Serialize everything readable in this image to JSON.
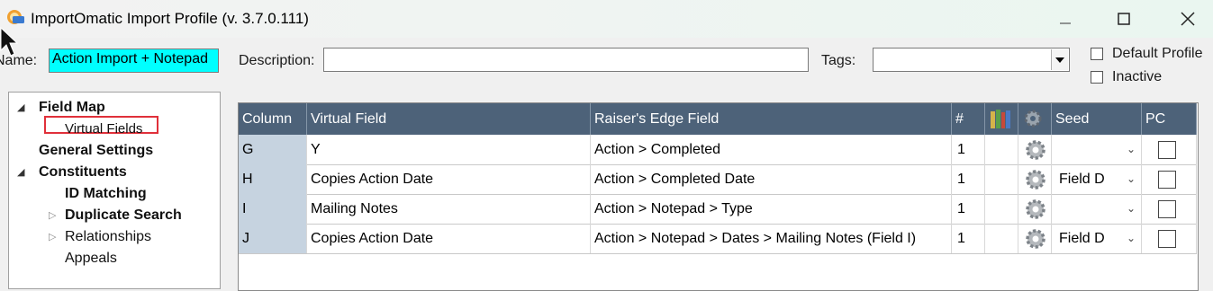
{
  "window": {
    "title": "ImportOmatic Import Profile (v. 3.7.0.111)",
    "controls": [
      "minimize",
      "maximize",
      "close"
    ]
  },
  "form": {
    "name_label": "Name:",
    "name_value": "Action Import + Notepad",
    "description_label": "Description:",
    "description_value": "",
    "tags_label": "Tags:",
    "tags_value": "",
    "default_profile_label": "Default Profile",
    "default_profile_checked": false,
    "inactive_label": "Inactive",
    "inactive_checked": false
  },
  "tree": {
    "items": [
      {
        "label": "Field Map",
        "bold": true,
        "expander": "expanded"
      },
      {
        "label": "Virtual Fields",
        "bold": false,
        "selected": true
      },
      {
        "label": "General Settings",
        "bold": true
      },
      {
        "label": "Constituents",
        "bold": true,
        "expander": "expanded"
      },
      {
        "label": "ID Matching",
        "bold": true
      },
      {
        "label": "Duplicate Search",
        "bold": true,
        "expander": "collapsed"
      },
      {
        "label": "Relationships",
        "bold": false,
        "expander": "collapsed"
      },
      {
        "label": "Appeals",
        "bold": false
      }
    ]
  },
  "grid": {
    "headers": {
      "column": "Column",
      "virtual_field": "Virtual Field",
      "re_field": "Raiser's Edge Field",
      "count": "#",
      "books_icon": "books-icon",
      "gear_icon": "gear-icon",
      "seed": "Seed",
      "pc": "PC"
    },
    "rows": [
      {
        "column": "G",
        "virtual_field": "Y",
        "re_field": "Action > Completed",
        "count": "1",
        "seed": "",
        "pc": false
      },
      {
        "column": "H",
        "virtual_field": "Copies Action Date",
        "re_field": "Action > Completed Date",
        "count": "1",
        "seed": "Field D",
        "pc": false
      },
      {
        "column": "I",
        "virtual_field": "Mailing Notes",
        "re_field": "Action > Notepad > Type",
        "count": "1",
        "seed": "",
        "pc": false
      },
      {
        "column": "J",
        "virtual_field": "Copies Action Date",
        "re_field": "Action > Notepad > Dates > Mailing Notes (Field I)",
        "count": "1",
        "seed": "Field D",
        "pc": false
      }
    ]
  },
  "colors": {
    "grid_header": "#4d6279",
    "column_cell": "#c6d3e0",
    "name_field": "#00ffff",
    "selection_outline": "#e0303a"
  }
}
